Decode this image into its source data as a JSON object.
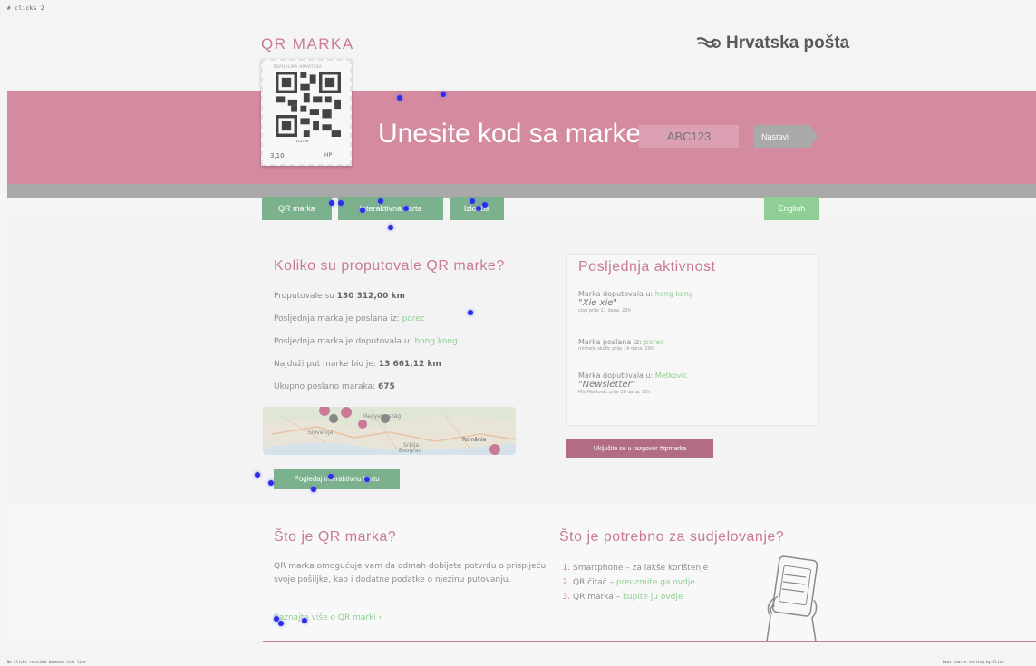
{
  "meta": {
    "header_text": "# clicks  2",
    "footer_left": "No clicks recorded beneath this line",
    "footer_right": "Heat source testing by Click"
  },
  "header": {
    "brand": "QR MARKA",
    "logo_text": "Hrvatska pošta"
  },
  "stamp": {
    "top_text": "REPUBLIKA HRVATSKA",
    "code": "¹¹³⁷⁹⁴",
    "price": "3,10",
    "hp": "HP"
  },
  "hero": {
    "title": "Unesite kod sa marke",
    "input_placeholder": "ABC123",
    "submit_label": "Nastavi"
  },
  "nav": {
    "items": [
      "QR marka",
      "Interaktivna karta",
      "Izložba"
    ],
    "language": "English"
  },
  "stats": {
    "title": "Koliko su proputovale QR marke?",
    "distance_prefix": "Proputovale su ",
    "distance": "130 312,00 km",
    "last_sent_prefix": "Posljednja marka je poslana iz: ",
    "last_sent": "porec",
    "last_arrived_prefix": "Posljednja marka je doputovala u: ",
    "last_arrived": "hong kong",
    "longest_prefix": "Najduži put marke bio je: ",
    "longest": "13 661,12 km",
    "total_prefix": "Ukupno poslano maraka: ",
    "total": "675",
    "map_button": "Pogledaj interaktivnu kartu",
    "map_labels": [
      "Magyarország",
      "Slovenija",
      "Srbija",
      "România",
      "Beograd"
    ]
  },
  "activity": {
    "title": "Posljednja aktivnost",
    "items": [
      {
        "prefix": "Marka doputovala u: ",
        "place": "hong kong",
        "quote": "\"Xie xie\"",
        "meta": "ciao prije 11 dana, 22h"
      },
      {
        "prefix": "Marka poslana iz: ",
        "place": "porec",
        "quote": "",
        "meta": "michele skofic prije 14 dana, 20h"
      },
      {
        "prefix": "Marka doputovala u: ",
        "place": "Metkovic",
        "quote": "\"Newsletter\"",
        "meta": "Mis Metković prije 38 dana, 15h"
      }
    ],
    "chat_button": "Uključite se u razgovor #qrmarka"
  },
  "about": {
    "title": "Što je QR marka?",
    "text": "QR marka omogućuje vam da odmah dobijete potvrdu o prispijeću svoje pošiljke, kao i dodatne podatke o njezinu putovanju.",
    "more": "Saznajte više o QR marki ›"
  },
  "requirements": {
    "title": "Što je potrebno za sudjelovanje?",
    "items": [
      {
        "text": "Smartphone – za lakše korištenje",
        "link": ""
      },
      {
        "text": "QR čitač – ",
        "link": "preuzmite ga ovdje"
      },
      {
        "text": "QR marka – ",
        "link": "kupite ju ovdje"
      }
    ]
  },
  "colors": {
    "brand_pink": "#d48a9f",
    "accent_green": "#7cb18e",
    "title_pink": "#c97a96",
    "click_dot": "#2a2ee6"
  }
}
